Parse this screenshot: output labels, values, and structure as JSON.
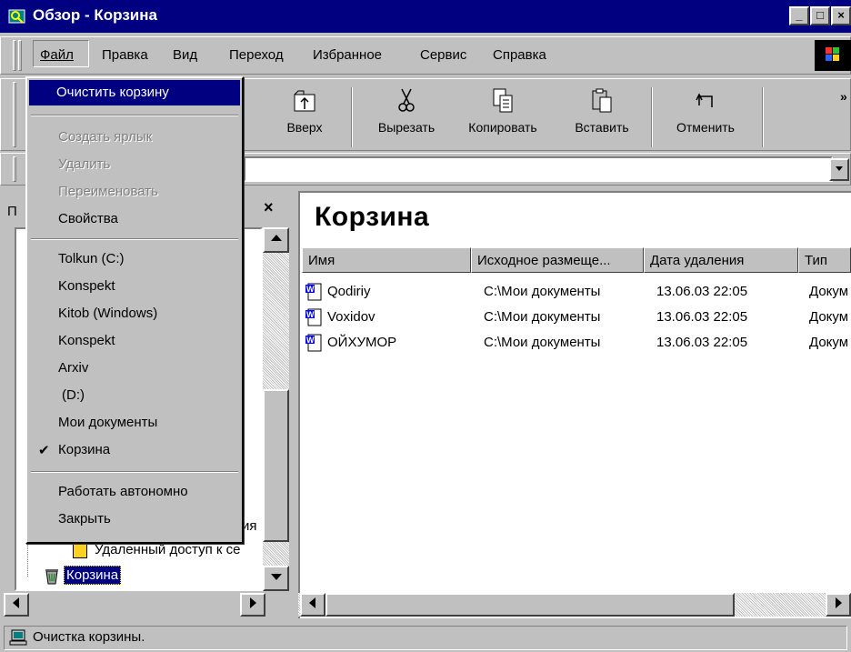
{
  "window": {
    "title": "Обзор - Корзина",
    "min_label": "_",
    "max_label": "□",
    "close_label": "×"
  },
  "menubar": {
    "file": "Файл",
    "edit": "Правка",
    "view": "Вид",
    "go": "Переход",
    "favorites": "Избранное",
    "tools": "Сервис",
    "help": "Справка"
  },
  "toolbar": {
    "up": "Вверх",
    "cut": "Вырезать",
    "copy": "Копировать",
    "paste": "Вставить",
    "undo": "Отменить",
    "more": "»"
  },
  "file_menu": {
    "empty_bin": "Очистить корзину",
    "create_shortcut": "Создать ярлык",
    "delete": "Удалить",
    "rename": "Переименовать",
    "properties": "Свойства",
    "places": [
      "Tolkun (C:)",
      "Konspekt",
      "Kitob (Windows)",
      "Konspekt",
      "Arxiv",
      "(D:)",
      "Мои документы"
    ],
    "current_place": "Корзина",
    "check_mark": "✔",
    "work_offline": "Работать автономно",
    "close": "Закрыть"
  },
  "left_pane": {
    "header_letter": "П",
    "close_label": "×",
    "tree": {
      "partial_item": "ия",
      "remote_access": "Удаленный доступ к се",
      "recycle_bin": "Корзина"
    }
  },
  "content": {
    "folder_title": "Корзина",
    "columns": [
      "Имя",
      "Исходное размеще...",
      "Дата удаления",
      "Тип"
    ],
    "rows": [
      {
        "name": "Qodiriy",
        "location": "C:\\Мои документы",
        "date": "13.06.03 22:05",
        "type": "Докум"
      },
      {
        "name": "Voxidov",
        "location": "C:\\Мои документы",
        "date": "13.06.03 22:05",
        "type": "Докум"
      },
      {
        "name": "ОЙХУМОР",
        "location": "C:\\Мои документы",
        "date": "13.06.03 22:05",
        "type": "Докум"
      }
    ]
  },
  "status": {
    "text": "Очистка корзины."
  },
  "colors": {
    "face": "#c0c0c0",
    "title_blue": "#000080",
    "highlight": "#000080"
  },
  "icons": [
    "explorer-icon",
    "up-folder-icon",
    "scissors-icon",
    "copy-icon",
    "paste-icon",
    "undo-icon",
    "windows-logo-icon",
    "doc-icon",
    "recycle-bin-icon",
    "computer-icon"
  ]
}
